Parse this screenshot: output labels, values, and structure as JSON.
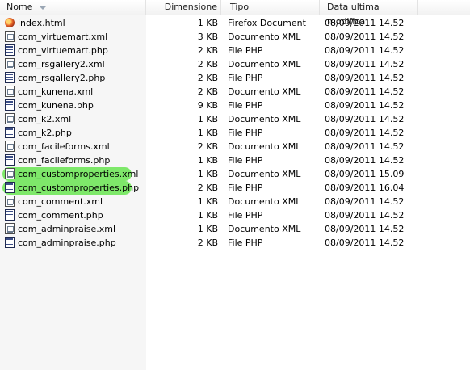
{
  "columns": {
    "name": "Nome",
    "size": "Dimensione",
    "type": "Tipo",
    "date": "Data ultima modifica"
  },
  "highlight_color": "#7ee86a",
  "files": [
    {
      "name": "index.html",
      "size": "1 KB",
      "type": "Firefox Document",
      "date": "08/09/2011 14.52",
      "icon": "firefox-html-icon",
      "highlighted": false
    },
    {
      "name": "com_virtuemart.xml",
      "size": "3 KB",
      "type": "Documento XML",
      "date": "08/09/2011 14.52",
      "icon": "xml-file-icon",
      "highlighted": false
    },
    {
      "name": "com_virtuemart.php",
      "size": "2 KB",
      "type": "File PHP",
      "date": "08/09/2011 14.52",
      "icon": "php-file-icon",
      "highlighted": false
    },
    {
      "name": "com_rsgallery2.xml",
      "size": "2 KB",
      "type": "Documento XML",
      "date": "08/09/2011 14.52",
      "icon": "xml-file-icon",
      "highlighted": false
    },
    {
      "name": "com_rsgallery2.php",
      "size": "2 KB",
      "type": "File PHP",
      "date": "08/09/2011 14.52",
      "icon": "php-file-icon",
      "highlighted": false
    },
    {
      "name": "com_kunena.xml",
      "size": "2 KB",
      "type": "Documento XML",
      "date": "08/09/2011 14.52",
      "icon": "xml-file-icon",
      "highlighted": false
    },
    {
      "name": "com_kunena.php",
      "size": "9 KB",
      "type": "File PHP",
      "date": "08/09/2011 14.52",
      "icon": "php-file-icon",
      "highlighted": false
    },
    {
      "name": "com_k2.xml",
      "size": "1 KB",
      "type": "Documento XML",
      "date": "08/09/2011 14.52",
      "icon": "xml-file-icon",
      "highlighted": false
    },
    {
      "name": "com_k2.php",
      "size": "1 KB",
      "type": "File PHP",
      "date": "08/09/2011 14.52",
      "icon": "php-file-icon",
      "highlighted": false
    },
    {
      "name": "com_facileforms.xml",
      "size": "2 KB",
      "type": "Documento XML",
      "date": "08/09/2011 14.52",
      "icon": "xml-file-icon",
      "highlighted": false
    },
    {
      "name": "com_facileforms.php",
      "size": "1 KB",
      "type": "File PHP",
      "date": "08/09/2011 14.52",
      "icon": "php-file-icon",
      "highlighted": false
    },
    {
      "name": "com_customproperties.xml",
      "size": "1 KB",
      "type": "Documento XML",
      "date": "08/09/2011 15.09",
      "icon": "xml-file-icon",
      "highlighted": true
    },
    {
      "name": "com_customproperties.php",
      "size": "2 KB",
      "type": "File PHP",
      "date": "08/09/2011 16.04",
      "icon": "php-file-icon",
      "highlighted": true
    },
    {
      "name": "com_comment.xml",
      "size": "1 KB",
      "type": "Documento XML",
      "date": "08/09/2011 14.52",
      "icon": "xml-file-icon",
      "highlighted": false
    },
    {
      "name": "com_comment.php",
      "size": "1 KB",
      "type": "File PHP",
      "date": "08/09/2011 14.52",
      "icon": "php-file-icon",
      "highlighted": false
    },
    {
      "name": "com_adminpraise.xml",
      "size": "1 KB",
      "type": "Documento XML",
      "date": "08/09/2011 14.52",
      "icon": "xml-file-icon",
      "highlighted": false
    },
    {
      "name": "com_adminpraise.php",
      "size": "2 KB",
      "type": "File PHP",
      "date": "08/09/2011 14.52",
      "icon": "php-file-icon",
      "highlighted": false
    }
  ]
}
